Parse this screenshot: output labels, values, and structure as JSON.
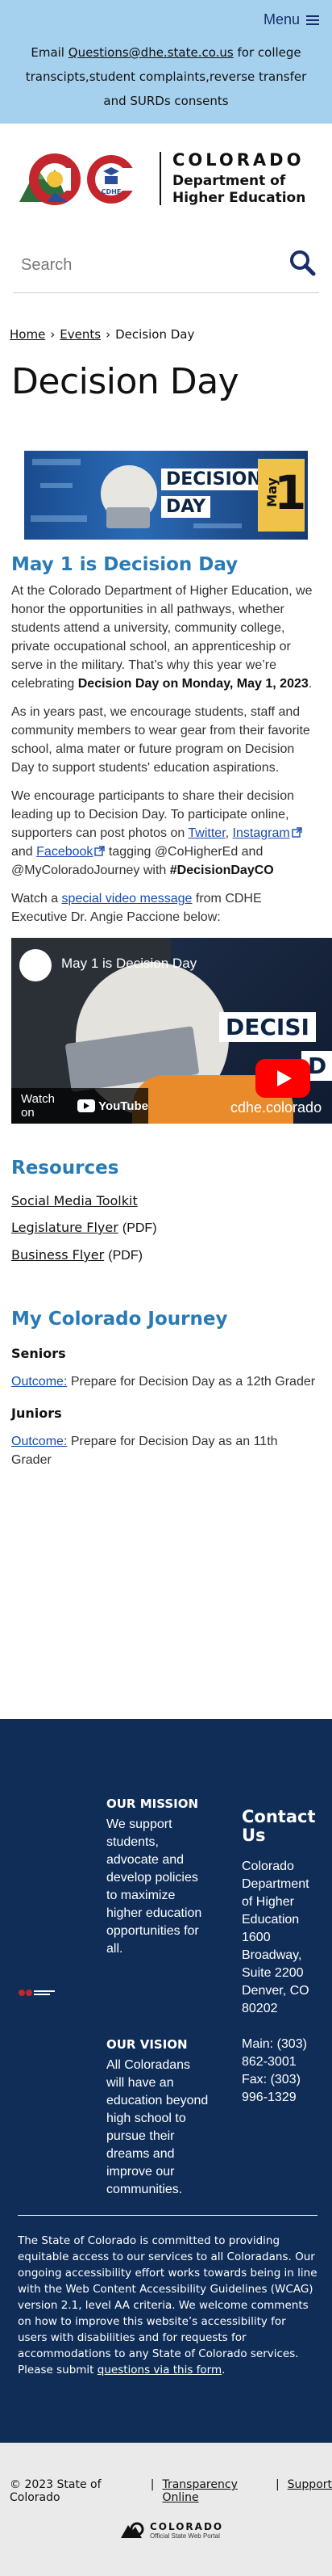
{
  "header": {
    "menu_label": "Menu",
    "banner_prefix": "Email",
    "banner_email": "Questions@dhe.state.co.us",
    "banner_suffix": "for college transcipts,student complaints,reverse transfer and SURDs consents"
  },
  "logo": {
    "line1": "COLORADO",
    "line2a": "Department of",
    "line2b": "Higher Education",
    "badge": "CDHE"
  },
  "search": {
    "placeholder": "Search"
  },
  "breadcrumb": {
    "items": [
      "Home",
      "Events",
      "Decision Day"
    ],
    "separator": "›"
  },
  "page": {
    "title": "Decision Day",
    "hero": {
      "word1": "DECISION",
      "word2": "DAY",
      "month": "May",
      "day": "1"
    },
    "section1_heading": "May 1 is Decision Day",
    "p1_text": "At the Colorado Department of Higher Education, we honor the opportunities in all pathways, whether students attend a university, community college, private occupational school, an apprenticeship or serve in the military. That’s why this year we’re celebrating",
    "p1_bold": "Decision Day on Monday, May 1, 2023",
    "p1_end": ".",
    "p2": "As in years past, we encourage students, staff and community members to wear gear from their favorite school, alma mater or future program on Decision Day to support students' education aspirations.",
    "p3_a": "We encourage participants to share their decision leading up to Decision Day. To participate online, supporters can post photos on",
    "p3_twitter": "Twitter",
    "p3_comma": ",",
    "p3_instagram": "Instagram",
    "p3_and": "and",
    "p3_facebook": "Facebook",
    "p3_b": "tagging @CoHigherEd and @MyColoradoJourney with",
    "p3_hashtag": "#DecisionDayCO",
    "p4_a": "Watch a",
    "p4_link": "special video message",
    "p4_b": "from CDHE Executive Dr. Angie Paccione below:"
  },
  "video": {
    "title": "May 1 is Decision Day",
    "badge1": "DECISI",
    "badge2": "D",
    "domain": "cdhe.colorado",
    "watch_on": "Watch on",
    "yt_label": "YouTube"
  },
  "resources": {
    "heading": "Resources",
    "items": [
      {
        "label": "Social Media Toolkit",
        "suffix": ""
      },
      {
        "label": "Legislature Flyer",
        "suffix": "(PDF)"
      },
      {
        "label": "Business Flyer",
        "suffix": "(PDF)"
      }
    ]
  },
  "journey": {
    "heading": "My Colorado Journey",
    "seniors_title": "Seniors",
    "seniors_link": "Outcome:",
    "seniors_text": "Prepare for Decision Day as a 12th Grader",
    "juniors_title": "Juniors",
    "juniors_link": "Outcome:",
    "juniors_text": "Prepare for Decision Day as an 11th Grader"
  },
  "footer": {
    "mission_title": "OUR MISSION",
    "mission_text": "We support students, advocate and develop policies to maximize higher education opportunities for all.",
    "vision_title": "OUR VISION",
    "vision_text": "All Coloradans will have an education beyond high school to pursue their dreams and improve our communities.",
    "contact_title": "Contact Us",
    "contact_address": "Colorado Department of Higher Education 1600 Broadway, Suite 2200 Denver, CO 80202",
    "contact_main": "Main: (303) 862-3001",
    "contact_fax": "Fax: (303) 996-1329",
    "access_text": "The State of Colorado is committed to providing equitable access to our services to all Coloradans. Our ongoing accessibility effort works towards being in line with the Web Content Accessibility Guidelines (WCAG) version 2.1, level AA criteria. We welcome comments on how to improve this website’s accessibility for users with disabilities and for requests for accommodations to any State of Colorado services. Please submit",
    "access_link": "questions via this form",
    "access_end": "."
  },
  "bottom": {
    "copyright": "© 2023 State of Colorado",
    "sep": "|",
    "transparency": "Transparency Online",
    "support": "Support",
    "portal_name": "COLORADO",
    "portal_sub": "Official State Web Portal"
  },
  "colors": {
    "banner_bg": "#a6d1ee",
    "heading_blue": "#2a7bb5",
    "footer_bg": "#0f2d57",
    "link_blue": "#1a4bb0"
  }
}
